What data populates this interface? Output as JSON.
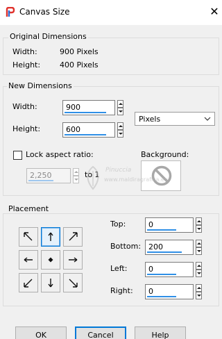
{
  "window": {
    "title": "Canvas Size",
    "close_symbol": "✕"
  },
  "original": {
    "group_title": "Original Dimensions",
    "width_label": "Width:",
    "width_value": "900 Pixels",
    "height_label": "Height:",
    "height_value": "400 Pixels"
  },
  "new_dims": {
    "group_title": "New Dimensions",
    "width_label": "Width:",
    "width_value": "900",
    "height_label": "Height:",
    "height_value": "600",
    "units_selected": "Pixels",
    "lock_label": "Lock aspect ratio:",
    "lock_checked": false,
    "ratio_value": "2,250",
    "ratio_suffix": "to 1",
    "background_label": "Background:"
  },
  "placement": {
    "group_title": "Placement",
    "selected_anchor": "top-center",
    "top_label": "Top:",
    "top_value": "0",
    "bottom_label": "Bottom:",
    "bottom_value": "200",
    "left_label": "Left:",
    "left_value": "0",
    "right_label": "Right:",
    "right_value": "0"
  },
  "buttons": {
    "ok": "OK",
    "cancel": "Cancel",
    "help": "Help"
  },
  "watermark": {
    "line1": "Pinuccia",
    "line2": "www.maldiragrafica.eu"
  },
  "colors": {
    "accent": "#0078d7",
    "field_underline": "#2f8fe6",
    "icon_red": "#e0312b",
    "icon_blue": "#2b6cd6"
  }
}
